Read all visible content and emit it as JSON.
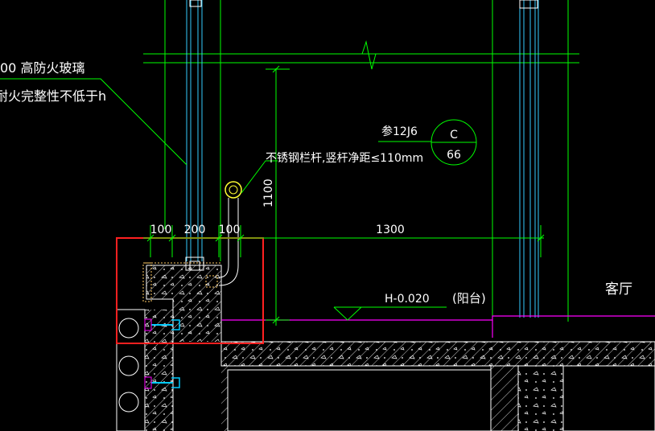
{
  "drawing": {
    "note_line1": "00  高防火玻璃",
    "note_line2": "耐火完整性不低于h",
    "ref_text": "参12J6",
    "detail_letter": "C",
    "detail_number": "66",
    "railing_note": "不锈钢栏杆,竖杆净距≤110mm",
    "height_dim": "1100",
    "dim_100_a": "100",
    "dim_200": "200",
    "dim_100_b": "100",
    "dim_1300": "1300",
    "elevation": "H-0.020",
    "balcony": "(阳台)",
    "living_room": "客厅"
  },
  "colors": {
    "background": "#000000",
    "dimension": "#00ff00",
    "glass": "#33ccff",
    "text": "#ffffff",
    "wall": "#ffffff",
    "highlight": "#ff2020",
    "floor_line": "#ff00ff",
    "handrail": "#ffff33"
  }
}
